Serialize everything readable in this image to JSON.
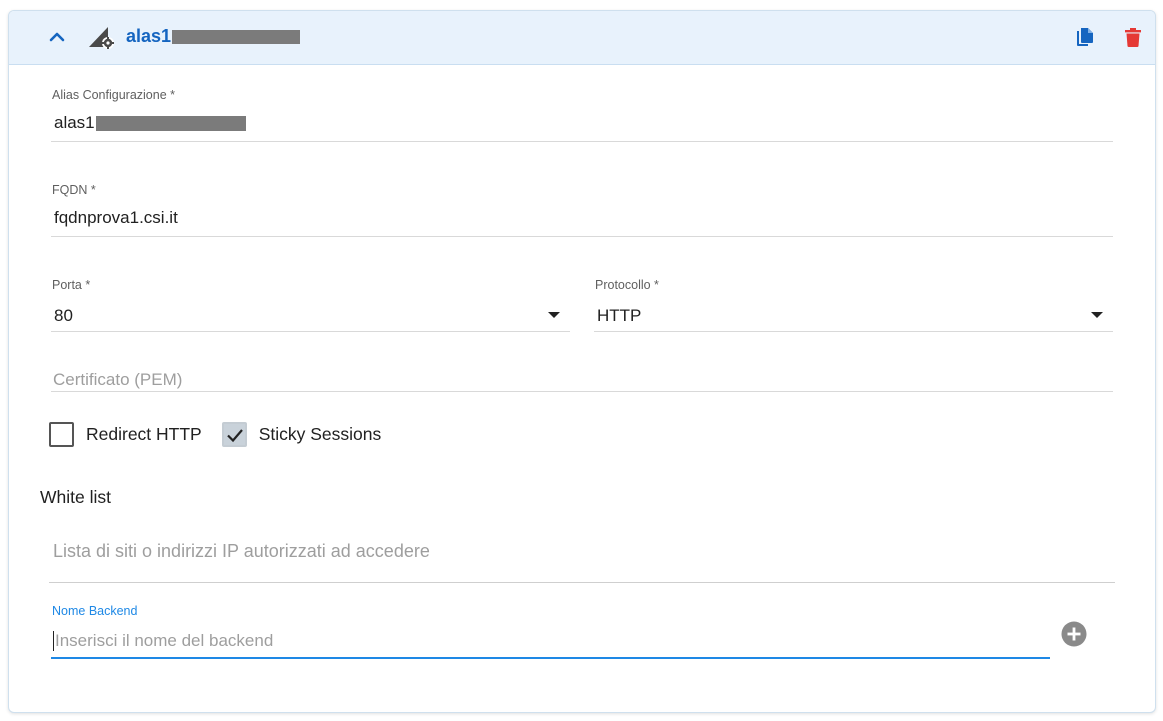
{
  "header": {
    "title_prefix": "alas1",
    "icons": {
      "collapse": "chevron-up-icon",
      "type": "load-balancer-settings-icon",
      "copy": "copy-icon",
      "delete": "delete-icon"
    },
    "accent_color": "#1565c0",
    "delete_color": "#e53935"
  },
  "form": {
    "alias": {
      "label": "Alias Configurazione *",
      "value_prefix": "alas1"
    },
    "fqdn": {
      "label": "FQDN *",
      "value": "fqdnprova1.csi.it"
    },
    "porta": {
      "label": "Porta *",
      "value": "80"
    },
    "protocollo": {
      "label": "Protocollo *",
      "value": "HTTP"
    },
    "certificato": {
      "placeholder": "Certificato (PEM)"
    },
    "redirect_http": {
      "label": "Redirect HTTP",
      "checked": false
    },
    "sticky_sessions": {
      "label": "Sticky Sessions",
      "checked": true
    },
    "white_list": {
      "title": "White list",
      "placeholder": "Lista di siti o indirizzi IP autorizzati ad accedere"
    },
    "nome_backend": {
      "label": "Nome Backend",
      "placeholder": "Inserisci il nome del backend",
      "focus_color": "#1e88e5"
    }
  }
}
